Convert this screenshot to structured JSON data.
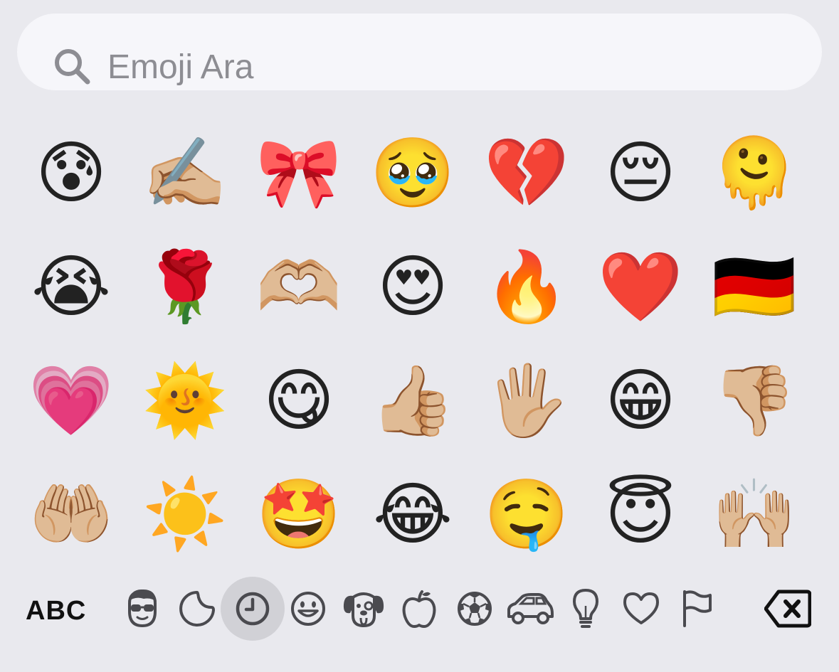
{
  "search": {
    "icon": "magnifier-icon",
    "placeholder": "Emoji Ara"
  },
  "emoji_grid": [
    "😰",
    "✍🏼",
    "🎀",
    "🥹",
    "💔",
    "😔",
    "🫠",
    "😭",
    "🌹",
    "🫶🏼",
    "😍",
    "🔥",
    "❤️",
    "🇩🇪",
    "💗",
    "🌞",
    "😋",
    "👍🏼",
    "🖐🏼",
    "😁",
    "👎🏼",
    "🤲🏼",
    "☀️",
    "🤩",
    "😂",
    "🤤",
    "😇",
    "🙌🏼"
  ],
  "toolbar": {
    "abc_label": "ABC",
    "categories": [
      {
        "icon": "memoji-stickers-icon"
      },
      {
        "icon": "sticker-icon"
      },
      {
        "icon": "clock-recent-icon",
        "selected": true
      },
      {
        "icon": "smiley-icon"
      },
      {
        "icon": "dog-face-icon"
      },
      {
        "icon": "apple-food-icon"
      },
      {
        "icon": "soccer-ball-icon"
      },
      {
        "icon": "car-icon"
      },
      {
        "icon": "lightbulb-icon"
      },
      {
        "icon": "heart-symbols-icon"
      },
      {
        "icon": "flag-icon"
      }
    ],
    "delete_icon": "delete-backspace-icon"
  },
  "colors": {
    "background": "#e9e9ee",
    "search_field": "#f6f6fa",
    "placeholder": "#8d8d93",
    "icon_gray": "#4a4a4f",
    "selected_category": "#d1d1d6"
  }
}
